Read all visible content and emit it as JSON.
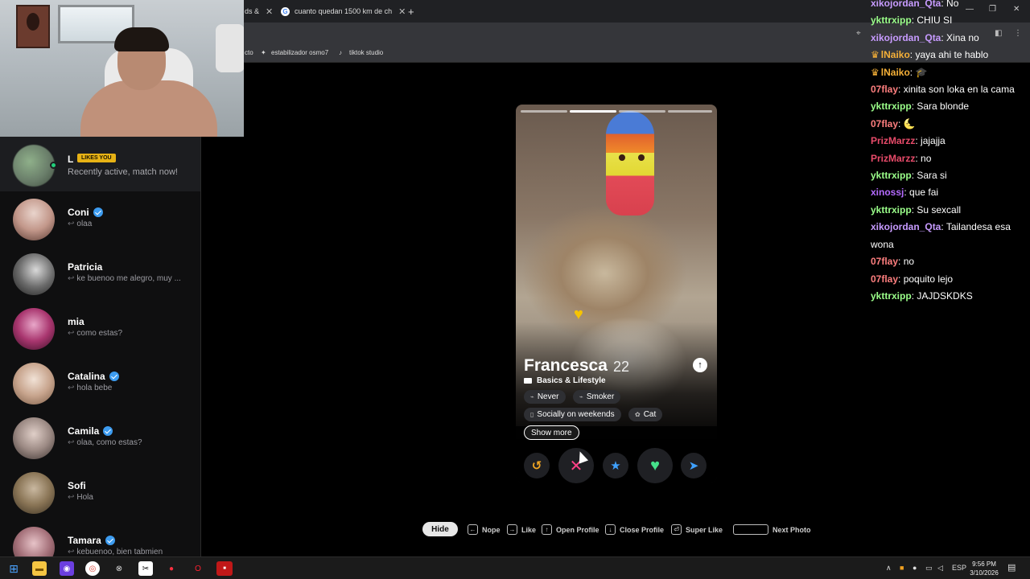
{
  "browser": {
    "tabs": [
      {
        "label": "ds &"
      },
      {
        "label": "cuanto quedan 1500 km de ch"
      }
    ],
    "new_tab_label": "+",
    "bookmarks": [
      {
        "label": "cto"
      },
      {
        "label": "estabilizador osmo7"
      },
      {
        "label": "tiktok studio"
      }
    ]
  },
  "left_panel": {
    "match": {
      "name": "L",
      "badge": "LIKES YOU",
      "subtitle": "Recently active, match now!"
    },
    "conversations": [
      {
        "name": "Coni",
        "verified": true,
        "last_message": "olaa"
      },
      {
        "name": "Patricia",
        "verified": false,
        "last_message": "ke buenoo me alegro, muy ..."
      },
      {
        "name": "mia",
        "verified": false,
        "last_message": "como estas?"
      },
      {
        "name": "Catalina",
        "verified": true,
        "last_message": "hola bebe"
      },
      {
        "name": "Camila",
        "verified": true,
        "last_message": "olaa, como estas?"
      },
      {
        "name": "Sofi",
        "verified": false,
        "last_message": "Hola"
      },
      {
        "name": "Tamara",
        "verified": true,
        "last_message": "kebuenoo, bien tabmien"
      }
    ]
  },
  "profile": {
    "name": "Francesca",
    "age": "22",
    "section_title": "Basics & Lifestyle",
    "chips": [
      {
        "icon": "smoking-icon",
        "label": "Never"
      },
      {
        "icon": "smoking-icon",
        "label": "Smoker"
      },
      {
        "icon": "drink-icon",
        "label": "Socially on weekends"
      },
      {
        "icon": "paw-icon",
        "label": "Cat"
      }
    ],
    "show_more_label": "Show more",
    "info_glyph": "↑"
  },
  "actions": {
    "rewind": "↺",
    "nope": "✕",
    "super_like": "★",
    "like": "♥",
    "boost": "➤"
  },
  "hints": {
    "hide_label": "Hide",
    "items": [
      {
        "key": "←",
        "label": "Nope"
      },
      {
        "key": "→",
        "label": "Like"
      },
      {
        "key": "↑",
        "label": "Open Profile"
      },
      {
        "key": "↓",
        "label": "Close Profile"
      },
      {
        "key": "⏎",
        "label": "Super Like"
      },
      {
        "key": "",
        "label": "Next Photo"
      }
    ]
  },
  "chat": [
    {
      "user": "xikojordan_Qta",
      "color": "#c79bff",
      "badge": "",
      "text": "No"
    },
    {
      "user": "ykttrxipp",
      "color": "#9bff8a",
      "badge": "",
      "text": "CHIU SI"
    },
    {
      "user": "xikojordan_Qta",
      "color": "#c79bff",
      "badge": "",
      "text": "Xina no"
    },
    {
      "user": "lNaiko",
      "color": "#f5b038",
      "badge": "♛",
      "text": "yaya ahi te hablo"
    },
    {
      "user": "lNaiko",
      "color": "#f5b038",
      "badge": "♛",
      "text": "🎓"
    },
    {
      "user": "07flay",
      "color": "#ff7f7f",
      "badge": "",
      "text": "xinita son loka en la cama"
    },
    {
      "user": "ykttrxipp",
      "color": "#9bff8a",
      "badge": "",
      "text": "Sara blonde"
    },
    {
      "user": "07flay",
      "color": "#ff7f7f",
      "badge": "",
      "text": "🌜"
    },
    {
      "user": "PrizMarzz",
      "color": "#e84b6a",
      "badge": "",
      "text": "jajajja"
    },
    {
      "user": "PrizMarzz",
      "color": "#e84b6a",
      "badge": "",
      "text": "no"
    },
    {
      "user": "ykttrxipp",
      "color": "#9bff8a",
      "badge": "",
      "text": "Sara si"
    },
    {
      "user": "xinossj",
      "color": "#b56bff",
      "badge": "",
      "text": "que fai"
    },
    {
      "user": "ykttrxipp",
      "color": "#9bff8a",
      "badge": "",
      "text": "Su sexcall"
    },
    {
      "user": "xikojordan_Qta",
      "color": "#c79bff",
      "badge": "",
      "text": "Tailandesa esa wona"
    },
    {
      "user": "07flay",
      "color": "#ff7f7f",
      "badge": "",
      "text": "no"
    },
    {
      "user": "07flay",
      "color": "#ff7f7f",
      "badge": "",
      "text": "poquito lejo"
    },
    {
      "user": "ykttrxipp",
      "color": "#9bff8a",
      "badge": "",
      "text": "JAJDSKDKS"
    }
  ],
  "taskbar": {
    "language": "ESP",
    "time": "9:56 PM",
    "date": "3/10/2026"
  }
}
